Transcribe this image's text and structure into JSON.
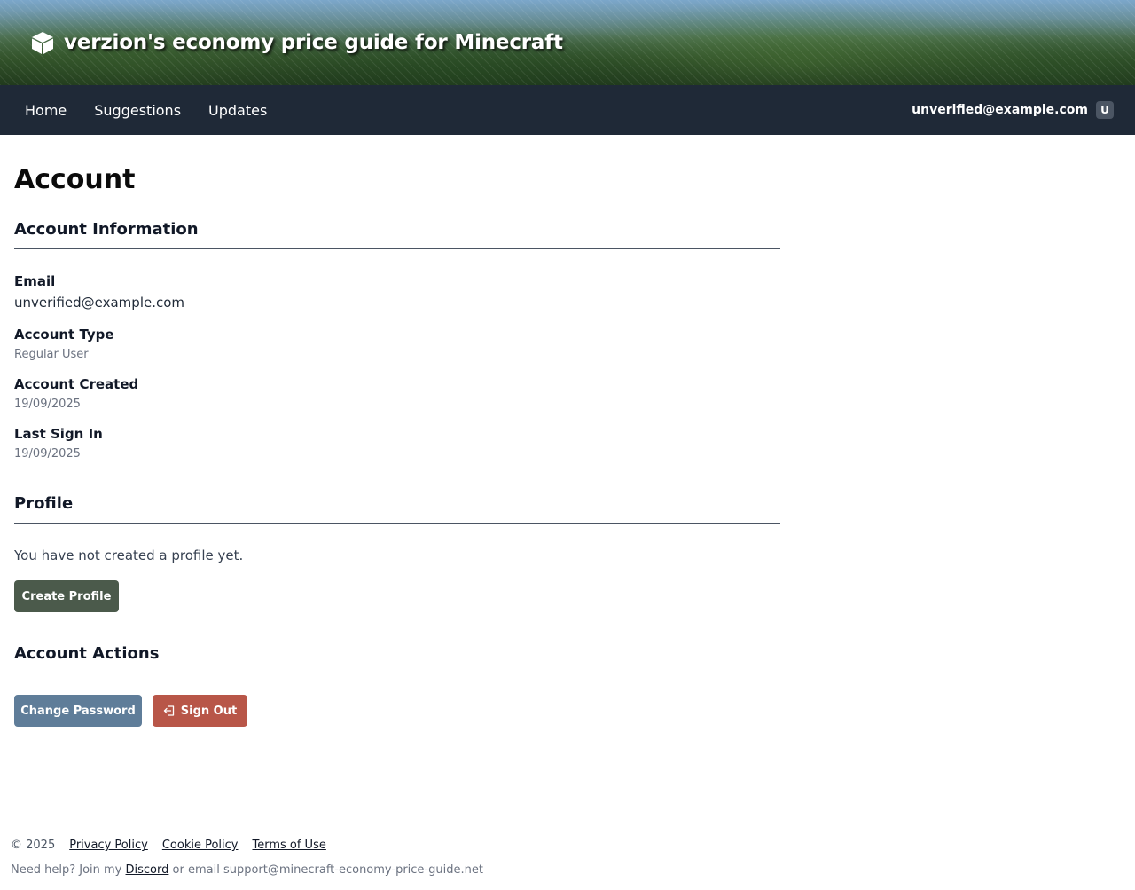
{
  "header": {
    "site_title": "verzion's economy price guide for Minecraft",
    "logo_icon": "cube-icon"
  },
  "nav": {
    "links": [
      {
        "label": "Home"
      },
      {
        "label": "Suggestions"
      },
      {
        "label": "Updates"
      }
    ],
    "user_email": "unverified@example.com",
    "user_initial": "U"
  },
  "page": {
    "title": "Account"
  },
  "account_info": {
    "heading": "Account Information",
    "email_label": "Email",
    "email_value": "unverified@example.com",
    "type_label": "Account Type",
    "type_value": "Regular User",
    "created_label": "Account Created",
    "created_value": "19/09/2025",
    "last_sign_in_label": "Last Sign In",
    "last_sign_in_value": "19/09/2025"
  },
  "profile": {
    "heading": "Profile",
    "message": "You have not created a profile yet.",
    "create_button": "Create Profile"
  },
  "actions": {
    "heading": "Account Actions",
    "change_password_button": "Change Password",
    "sign_out_button": "Sign Out",
    "sign_out_icon": "sign-out-icon"
  },
  "footer": {
    "copyright": "© 2025",
    "links": [
      "Privacy Policy",
      "Cookie Policy",
      "Terms of Use"
    ],
    "help_prefix": "Need help? Join my",
    "discord_label": "Discord",
    "help_suffix": "or email support@minecraft-economy-price-guide.net"
  },
  "colors": {
    "nav_background": "#1f2937",
    "create_button": "#4b5a4b",
    "change_password_button": "#5f7d99",
    "sign_out_button": "#b85648"
  }
}
